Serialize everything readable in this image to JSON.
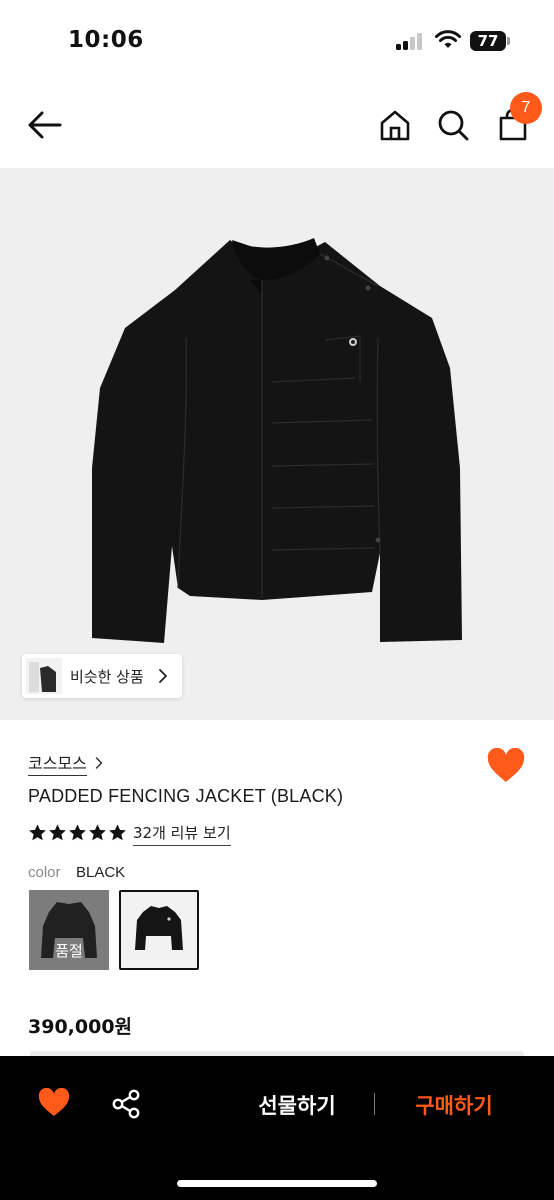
{
  "status_bar": {
    "time": "10:06",
    "battery": "77"
  },
  "header": {
    "cart_count": "7"
  },
  "product": {
    "similar_label": "비슷한 상품",
    "brand": "코스모스",
    "name": "PADDED FENCING JACKET (BLACK)",
    "rating_stars": 5,
    "review_link": "32개 리뷰 보기",
    "color_label": "color",
    "color_value": "BLACK",
    "swatches": [
      {
        "label": "품절",
        "sold_out": true
      },
      {
        "label": "",
        "selected": true
      }
    ],
    "price": "390,000원"
  },
  "bottom_bar": {
    "gift_label": "선물하기",
    "buy_label": "구매하기"
  },
  "colors": {
    "accent": "#ff5a1a",
    "image_bg": "#efefef",
    "bottom_bar_bg": "#000000"
  }
}
